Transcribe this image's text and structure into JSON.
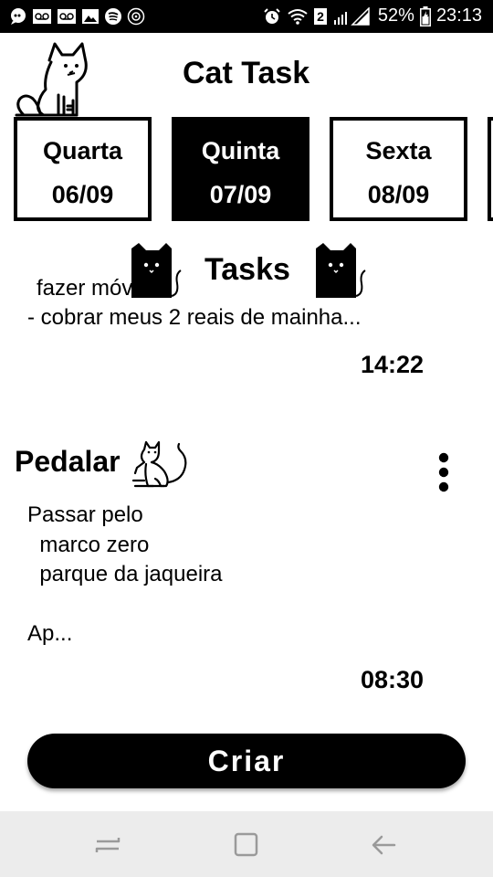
{
  "status_bar": {
    "battery": "52%",
    "time": "23:13",
    "sim_badge": "2",
    "icons": [
      "chat-icon",
      "voicemail-icon",
      "voicemail-icon",
      "image-icon",
      "spotify-icon",
      "sync-icon",
      "alarm-icon",
      "wifi-icon",
      "signal-icon",
      "battery-icon"
    ]
  },
  "header": {
    "title": "Cat Task"
  },
  "days": [
    {
      "name": "Quarta",
      "date": "06/09",
      "selected": false
    },
    {
      "name": "Quinta",
      "date": "07/09",
      "selected": true
    },
    {
      "name": "Sexta",
      "date": "08/09",
      "selected": false
    }
  ],
  "tasks_section": {
    "title": "Tasks"
  },
  "tasks": [
    {
      "title": "",
      "partial_line": "fazer móvel;",
      "body": "- cobrar meus 2 reais de mainha...",
      "time": "14:22"
    },
    {
      "title": "Pedalar",
      "body": "Passar pelo\n  marco zero\n  parque da jaqueira\n\nAp...",
      "time": "08:30"
    }
  ],
  "create_button": {
    "label": "Criar"
  },
  "nav": {
    "icons": [
      "recents-icon",
      "home-icon",
      "back-icon"
    ]
  }
}
